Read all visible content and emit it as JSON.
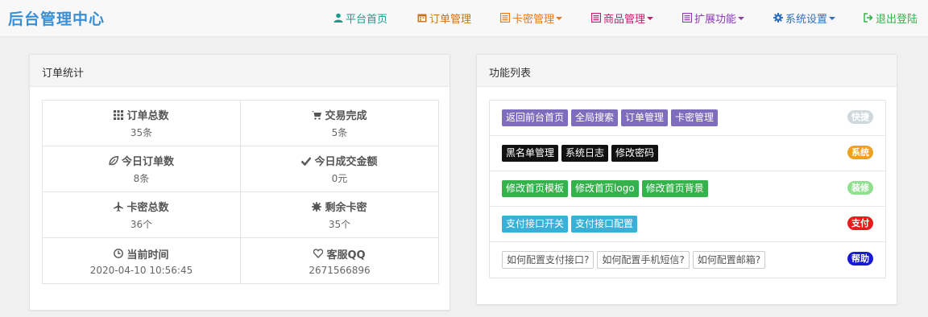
{
  "brand": "后台管理中心",
  "nav": [
    {
      "label": "平台首页",
      "icon": "user-icon",
      "color": "#1a9b8c",
      "dropdown": false
    },
    {
      "label": "订单管理",
      "icon": "calendar-icon",
      "color": "#c8731f",
      "dropdown": false
    },
    {
      "label": "卡密管理",
      "icon": "list-icon",
      "color": "#e8791c",
      "dropdown": true
    },
    {
      "label": "商品管理",
      "icon": "list-alt-icon",
      "color": "#c02070",
      "dropdown": true
    },
    {
      "label": "扩展功能",
      "icon": "list-alt-icon",
      "color": "#8e3cb0",
      "dropdown": true
    },
    {
      "label": "系统设置",
      "icon": "gear-icon",
      "color": "#2e6fbf",
      "dropdown": true
    },
    {
      "label": "退出登陆",
      "icon": "logout-icon",
      "color": "#35b24b",
      "dropdown": false
    }
  ],
  "order_panel": {
    "title": "订单统计",
    "stats": [
      {
        "label": "订单总数",
        "value": "35条",
        "icon": "grid-icon"
      },
      {
        "label": "交易完成",
        "value": "5条",
        "icon": "cart-icon"
      },
      {
        "label": "今日订单数",
        "value": "8条",
        "icon": "leaf-icon"
      },
      {
        "label": "今日成交金额",
        "value": "0元",
        "icon": "check-icon"
      },
      {
        "label": "卡密总数",
        "value": "36个",
        "icon": "plane-icon"
      },
      {
        "label": "剩余卡密",
        "value": "35个",
        "icon": "asterisk-icon"
      },
      {
        "label": "当前时间",
        "value": "2020-04-10 10:56:45",
        "icon": "clock-icon"
      },
      {
        "label": "客服QQ",
        "value": "2671566896",
        "icon": "heart-icon"
      }
    ]
  },
  "func_panel": {
    "title": "功能列表",
    "rows": [
      {
        "tag": "快捷",
        "tag_color": "#cfd8dc",
        "style": "purple",
        "buttons": [
          "返回前台首页",
          "全局搜索",
          "订单管理",
          "卡密管理"
        ]
      },
      {
        "tag": "系统",
        "tag_color": "#f0a020",
        "style": "black",
        "buttons": [
          "黑名单管理",
          "系统日志",
          "修改密码"
        ]
      },
      {
        "tag": "装修",
        "tag_color": "#8fe08f",
        "style": "green",
        "buttons": [
          "修改首页模板",
          "修改首页logo",
          "修改首页背景"
        ]
      },
      {
        "tag": "支付",
        "tag_color": "#e81c1c",
        "style": "cyan",
        "buttons": [
          "支付接口开关",
          "支付接口配置"
        ]
      },
      {
        "tag": "帮助",
        "tag_color": "#1818d8",
        "style": "outline",
        "buttons": [
          "如何配置支付接口?",
          "如何配置手机短信?",
          "如何配置邮箱?"
        ]
      }
    ]
  }
}
